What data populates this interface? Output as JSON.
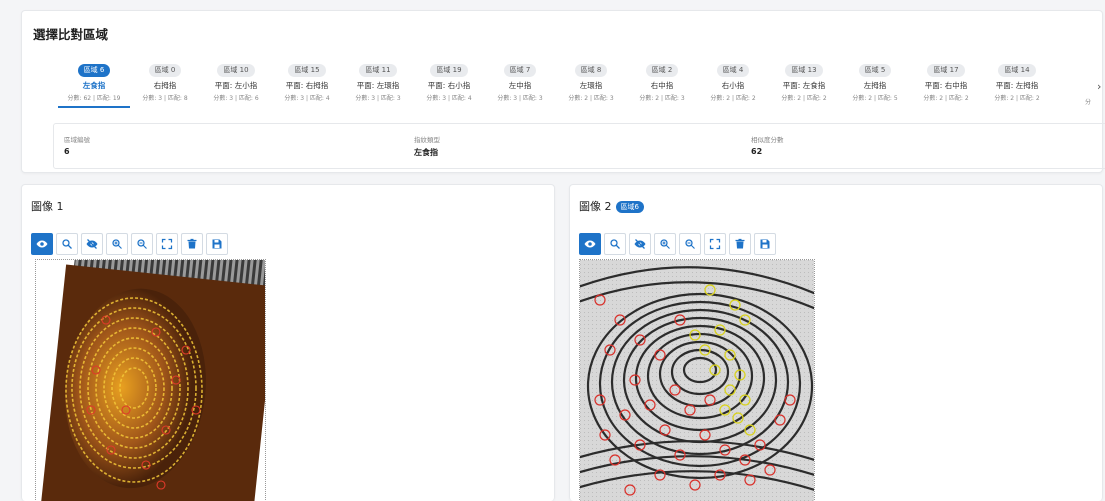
{
  "selector": {
    "title": "選擇比對區域",
    "tabs": [
      {
        "region": "區域 6",
        "finger": "左食指",
        "score": "分數: 62 | 匹配: 19",
        "active": true
      },
      {
        "region": "區域 0",
        "finger": "右拇指",
        "score": "分數: 3 | 匹配: 8"
      },
      {
        "region": "區域 10",
        "finger": "平面: 左小指",
        "score": "分數: 3 | 匹配: 6"
      },
      {
        "region": "區域 15",
        "finger": "平面: 右拇指",
        "score": "分數: 3 | 匹配: 4"
      },
      {
        "region": "區域 11",
        "finger": "平面: 左環指",
        "score": "分數: 3 | 匹配: 3"
      },
      {
        "region": "區域 19",
        "finger": "平面: 右小指",
        "score": "分數: 3 | 匹配: 4"
      },
      {
        "region": "區域 7",
        "finger": "左中指",
        "score": "分數: 3 | 匹配: 3"
      },
      {
        "region": "區域 8",
        "finger": "左環指",
        "score": "分數: 2 | 匹配: 3"
      },
      {
        "region": "區域 2",
        "finger": "右中指",
        "score": "分數: 2 | 匹配: 3"
      },
      {
        "region": "區域 4",
        "finger": "右小指",
        "score": "分數: 2 | 匹配: 2"
      },
      {
        "region": "區域 13",
        "finger": "平面: 左食指",
        "score": "分數: 2 | 匹配: 2"
      },
      {
        "region": "區域 5",
        "finger": "左拇指",
        "score": "分數: 2 | 匹配: 5"
      },
      {
        "region": "區域 17",
        "finger": "平面: 右中指",
        "score": "分數: 2 | 匹配: 2"
      },
      {
        "region": "區域 14",
        "finger": "平面: 左拇指",
        "score": "分數: 2 | 匹配: 2"
      }
    ],
    "partial_text": "分",
    "next_icon": "chevron-right-icon",
    "info": {
      "region_label": "區域編號",
      "region_value": "6",
      "type_label": "指紋類型",
      "type_value": "左食指",
      "score_label": "相似度分數",
      "score_value": "62"
    }
  },
  "panels": [
    {
      "title": "圖像 1",
      "badge": ""
    },
    {
      "title": "圖像 2",
      "badge": "區域6"
    }
  ],
  "toolbar": {
    "buttons": [
      "eye-icon",
      "search-icon",
      "eye-off-icon",
      "zoom-in-icon",
      "zoom-out-icon",
      "fullscreen-icon",
      "delete-icon",
      "save-icon"
    ],
    "active": "eye-icon"
  },
  "colors": {
    "accent": "#1e73c8",
    "marker_red": "#d9302a",
    "marker_yellow": "#d9d21e",
    "latent_print_bg": "#5a2a0c",
    "latent_print_ridges": "#f0c030"
  }
}
